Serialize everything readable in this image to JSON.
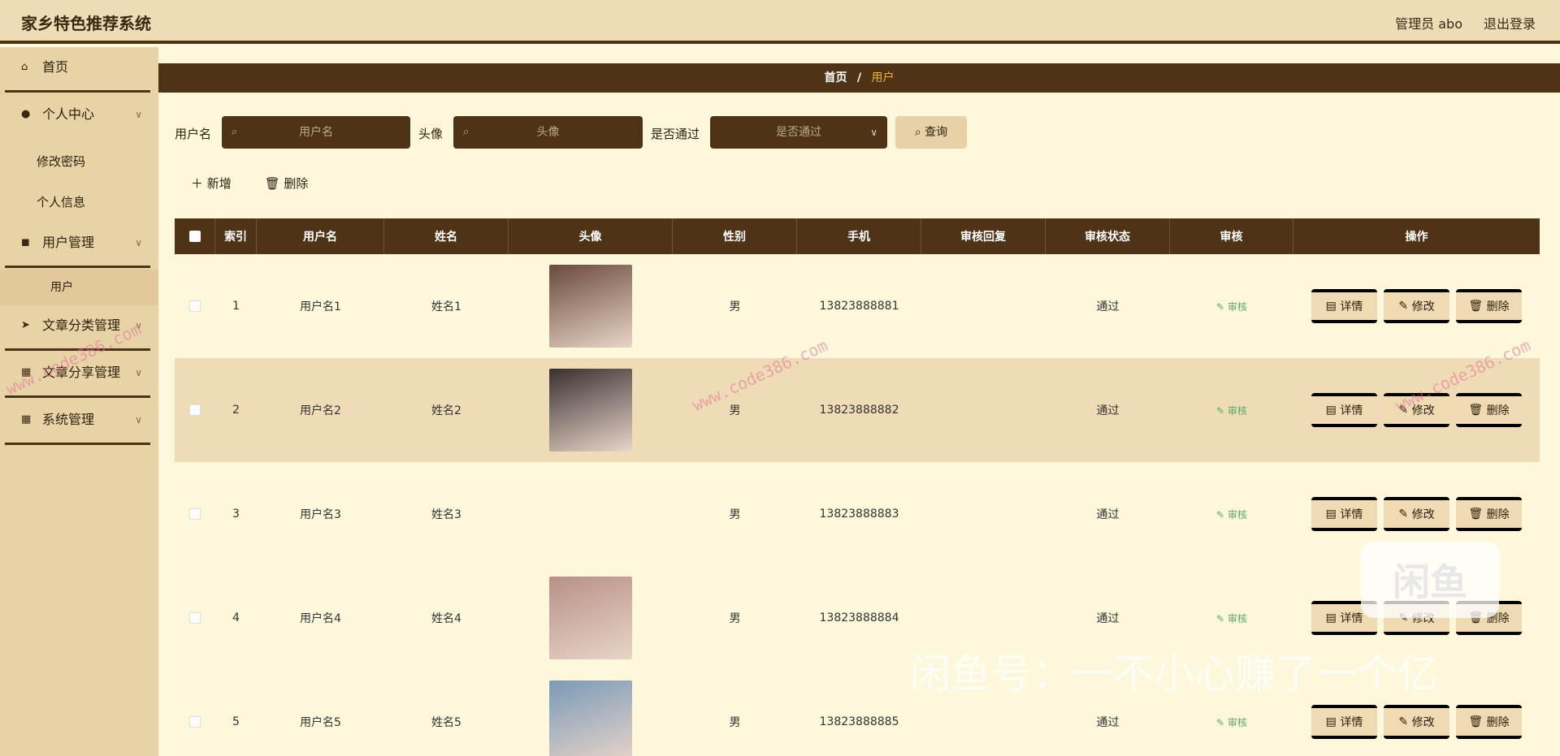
{
  "header": {
    "title": "家乡特色推荐系统",
    "admin_label": "管理员 abo",
    "logout_label": "退出登录"
  },
  "sidebar": {
    "items": [
      {
        "label": "首页",
        "icon": "home-icon"
      },
      {
        "label": "个人中心",
        "icon": "user-icon"
      },
      {
        "label": "修改密码"
      },
      {
        "label": "个人信息"
      },
      {
        "label": "用户管理",
        "icon": "users-icon"
      },
      {
        "label": "用户"
      },
      {
        "label": "文章分类管理",
        "icon": "send-icon"
      },
      {
        "label": "文章分享管理",
        "icon": "grid-icon"
      },
      {
        "label": "系统管理",
        "icon": "grid-icon"
      }
    ]
  },
  "breadcrumb": {
    "home": "首页",
    "sep": "/",
    "current": "用户"
  },
  "search": {
    "username_label": "用户名",
    "username_placeholder": "用户名",
    "avatar_label": "头像",
    "avatar_placeholder": "头像",
    "pass_label": "是否通过",
    "pass_placeholder": "是否通过",
    "query_label": "查询"
  },
  "actions": {
    "add_label": "新增",
    "delete_label": "删除"
  },
  "table": {
    "headers": [
      "索引",
      "用户名",
      "姓名",
      "头像",
      "性别",
      "手机",
      "审核回复",
      "审核状态",
      "审核",
      "操作"
    ],
    "rows": [
      {
        "index": "1",
        "username": "用户名1",
        "name": "姓名1",
        "gender": "男",
        "phone": "13823888881",
        "reply": "",
        "status": "通过",
        "audit": "审核",
        "avatar_color": "#6a4a3c",
        "has_avatar": true
      },
      {
        "index": "2",
        "username": "用户名2",
        "name": "姓名2",
        "gender": "男",
        "phone": "13823888882",
        "reply": "",
        "status": "通过",
        "audit": "审核",
        "avatar_color": "#3a3030",
        "has_avatar": true
      },
      {
        "index": "3",
        "username": "用户名3",
        "name": "姓名3",
        "gender": "男",
        "phone": "13823888883",
        "reply": "",
        "status": "通过",
        "audit": "审核",
        "avatar_color": "",
        "has_avatar": false
      },
      {
        "index": "4",
        "username": "用户名4",
        "name": "姓名4",
        "gender": "男",
        "phone": "13823888884",
        "reply": "",
        "status": "通过",
        "audit": "审核",
        "avatar_color": "#b89088",
        "has_avatar": true
      },
      {
        "index": "5",
        "username": "用户名5",
        "name": "姓名5",
        "gender": "男",
        "phone": "13823888885",
        "reply": "",
        "status": "通过",
        "audit": "审核",
        "avatar_color": "#7a9ab8",
        "has_avatar": true
      }
    ],
    "op_labels": {
      "detail": "详情",
      "edit": "修改",
      "delete": "删除"
    }
  },
  "overlays": {
    "watermark": "www.code386.com",
    "xianyu_badge": "闲鱼",
    "xianyu_text": "闲鱼号：一不小心赚了一个亿"
  }
}
